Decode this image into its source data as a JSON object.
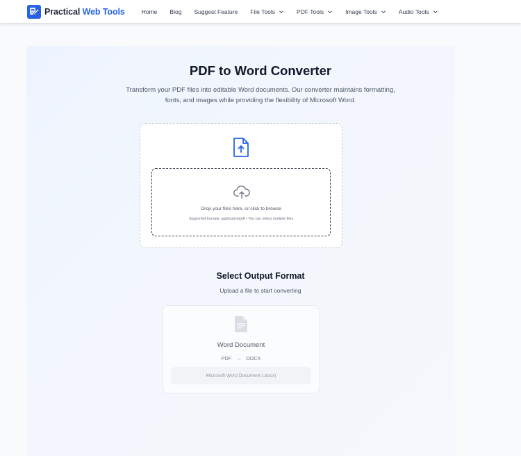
{
  "brand": {
    "name_part1": "Practical ",
    "name_part2": "Web Tools",
    "accent_color": "#2563eb"
  },
  "nav": {
    "items": [
      {
        "label": "Home",
        "dropdown": false
      },
      {
        "label": "Blog",
        "dropdown": false
      },
      {
        "label": "Suggest Feature",
        "dropdown": false
      },
      {
        "label": "File Tools",
        "dropdown": true
      },
      {
        "label": "PDF Tools",
        "dropdown": true
      },
      {
        "label": "Image Tools",
        "dropdown": true
      },
      {
        "label": "Audio Tools",
        "dropdown": true
      }
    ]
  },
  "main": {
    "title": "PDF to Word Converter",
    "description": "Transform your PDF files into editable Word documents. Our converter maintains formatting, fonts, and images while providing the flexibility of Microsoft Word."
  },
  "upload": {
    "header_icon": "file-upload-icon",
    "drop_icon": "cloud-upload-icon",
    "drop_text": "Drop your files here, or click to browse",
    "supported_text": "Supported formats: application/pdf • You can select multiple files"
  },
  "output": {
    "title": "Select Output Format",
    "subtitle": "Upload a file to start converting",
    "formats": [
      {
        "icon": "document-icon",
        "name": "Word Document",
        "from": "PDF",
        "to": "DOCX",
        "description": "Microsoft Word Document (.docx)"
      }
    ]
  }
}
